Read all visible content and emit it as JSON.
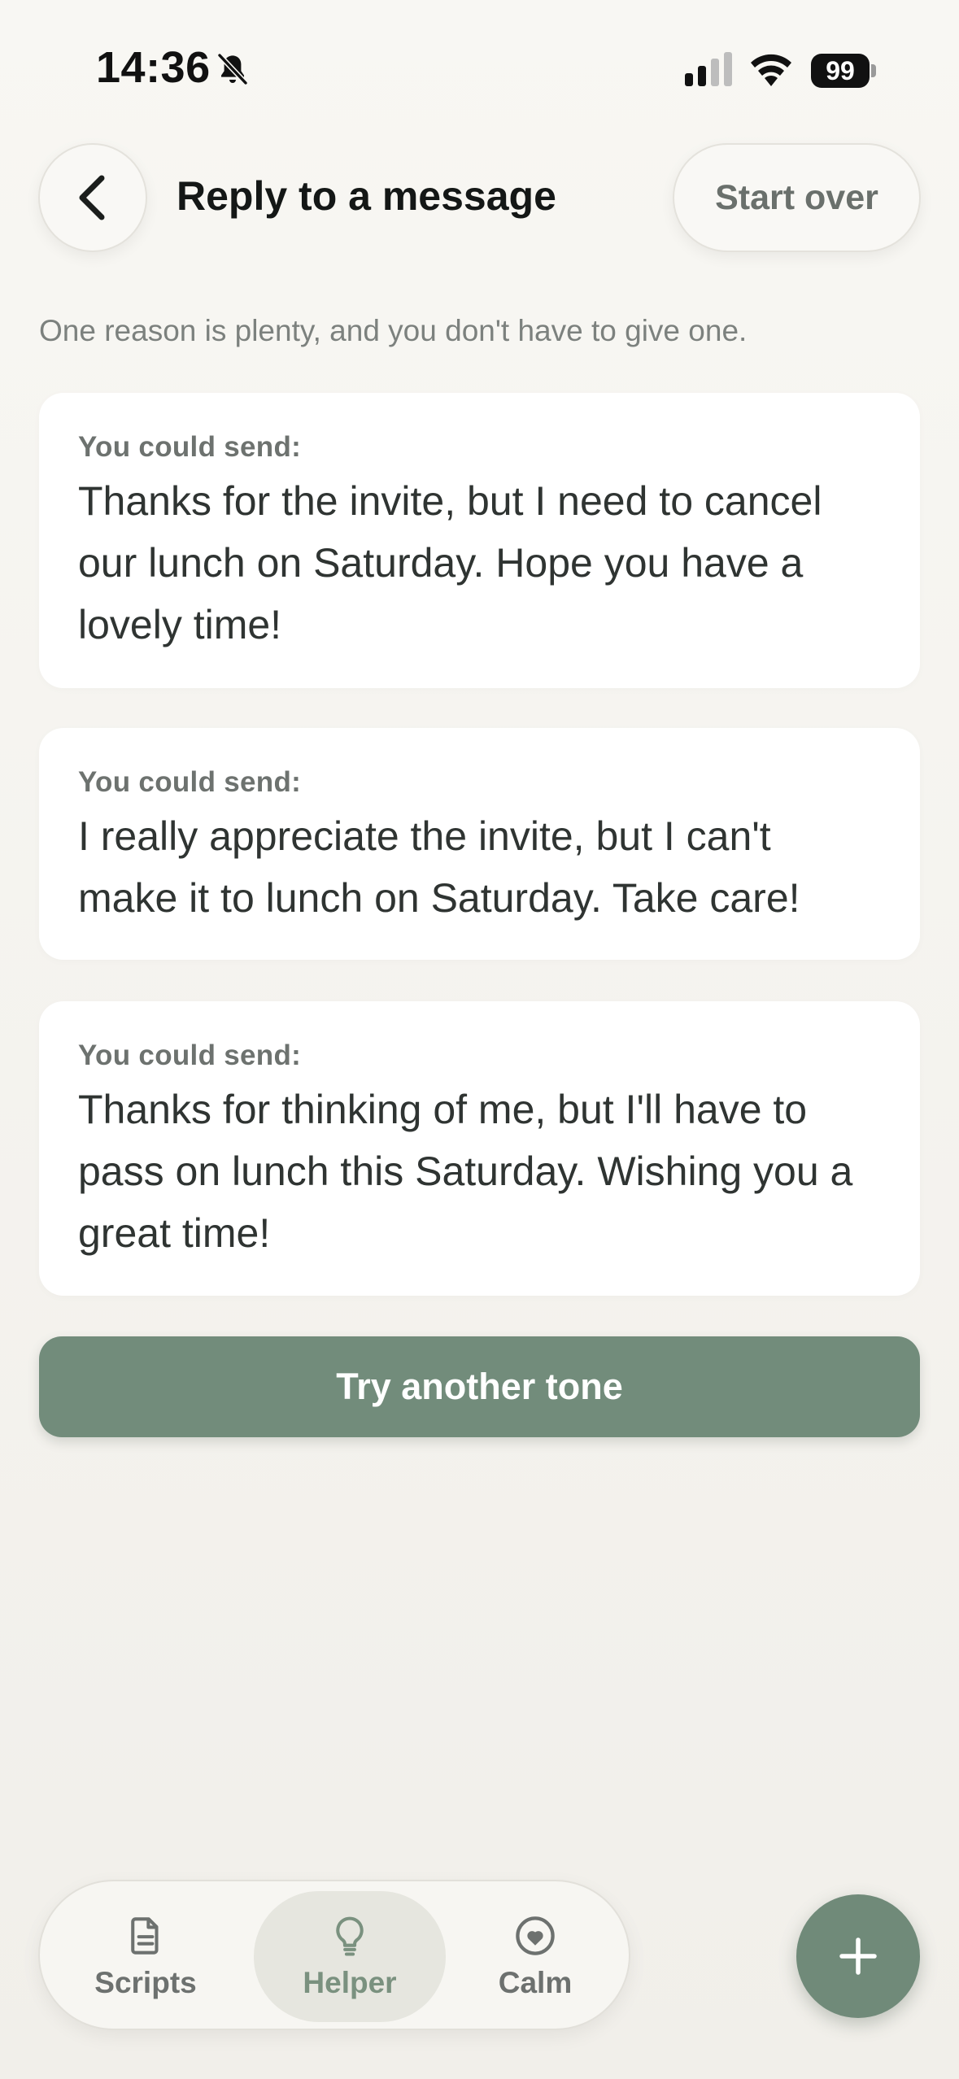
{
  "status_bar": {
    "time": "14:36",
    "battery": "99",
    "icons": [
      "bell-slash-icon",
      "cellular-signal-icon",
      "wifi-icon",
      "battery-icon"
    ]
  },
  "header": {
    "back_icon": "chevron-left-icon",
    "title": "Reply to a message",
    "start_over_label": "Start over"
  },
  "subtitle": "One reason is plenty, and you don't have to give one.",
  "suggestions": [
    {
      "label": "You could send:",
      "text": "Thanks for the invite, but I need to cancel our lunch on Saturday. Hope you have a lovely time!"
    },
    {
      "label": "You could send:",
      "text": "I really appreciate the invite, but I can't make it to lunch on Saturday. Take care!"
    },
    {
      "label": "You could send:",
      "text": "Thanks for thinking of me, but I'll have to pass on lunch this Saturday. Wishing you a great time!"
    }
  ],
  "tone_button_label": "Try another tone",
  "tab_bar": {
    "tabs": [
      {
        "label": "Scripts",
        "icon": "document-icon"
      },
      {
        "label": "Helper",
        "icon": "lightbulb-icon",
        "selected": true
      },
      {
        "label": "Calm",
        "icon": "heart-circle-icon"
      }
    ]
  },
  "fab_icon": "plus-icon",
  "colors": {
    "accent": "#728c7b",
    "background": "#f4f3ef",
    "card": "#ffffff"
  }
}
